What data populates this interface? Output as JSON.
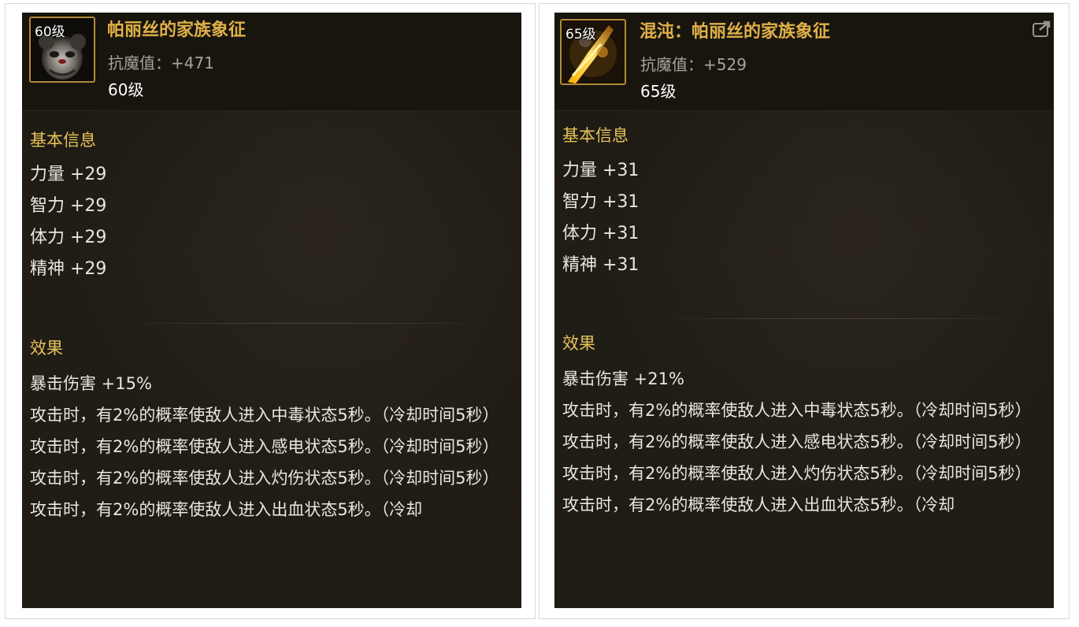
{
  "left": {
    "icon_level": "60级",
    "name": "帕丽丝的家族象征",
    "stat_label": "抗魔值：",
    "stat_value": "+471",
    "level": "60级",
    "basic_title": "基本信息",
    "attributes": [
      "力量 +29",
      "智力 +29",
      "体力 +29",
      "精神 +29"
    ],
    "effect_title": "效果",
    "effects": [
      "暴击伤害 +15%",
      "攻击时，有2%的概率使敌人进入中毒状态5秒。（冷却时间5秒）",
      "攻击时，有2%的概率使敌人进入感电状态5秒。（冷却时间5秒）",
      "攻击时，有2%的概率使敌人进入灼伤状态5秒。（冷却时间5秒）",
      "攻击时，有2%的概率使敌人进入出血状态5秒。（冷却"
    ]
  },
  "right": {
    "icon_level": "65级",
    "name": "混沌：帕丽丝的家族象征",
    "stat_label": "抗魔值：",
    "stat_value": "+529",
    "level": "65级",
    "basic_title": "基本信息",
    "attributes": [
      "力量 +31",
      "智力 +31",
      "体力 +31",
      "精神 +31"
    ],
    "effect_title": "效果",
    "effects": [
      "暴击伤害 +21%",
      "攻击时，有2%的概率使敌人进入中毒状态5秒。（冷却时间5秒）",
      "攻击时，有2%的概率使敌人进入感电状态5秒。（冷却时间5秒）",
      "攻击时，有2%的概率使敌人进入灼伤状态5秒。（冷却时间5秒）",
      "攻击时，有2%的概率使敌人进入出血状态5秒。（冷却"
    ]
  },
  "colors": {
    "name": "#e0b148",
    "section_title": "#e6c25a",
    "stat": "#a7a39b",
    "text": "#eae6dc",
    "panel_bg": "#1f1b15",
    "icon_border": "#b08a3a"
  },
  "icons": {
    "left_item": "mask-emblem-icon",
    "right_item": "flame-emblem-icon",
    "expand": "expand-icon"
  }
}
